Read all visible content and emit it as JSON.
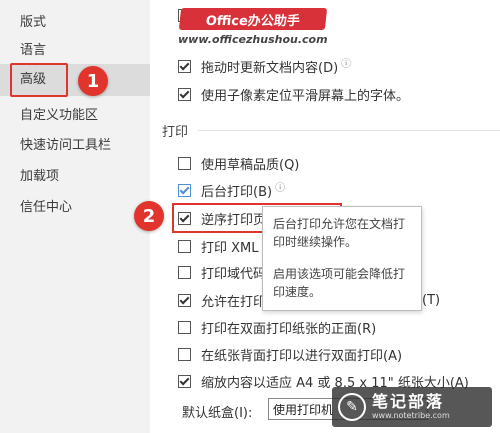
{
  "sidebar": {
    "items": [
      {
        "label": "版式"
      },
      {
        "label": "语言"
      },
      {
        "label": "高级"
      },
      {
        "label": "自定义功能区"
      },
      {
        "label": "快速访问工具栏"
      },
      {
        "label": "加载项"
      },
      {
        "label": "信任中心"
      }
    ],
    "selected": "高级"
  },
  "badges": {
    "one": "1",
    "two": "2"
  },
  "watermark": {
    "banner": "Office办公助手",
    "url": "www.officezhushou.com",
    "corner_title": "笔记部落",
    "corner_url": "www.notetribe.com"
  },
  "options_top": [
    {
      "label": "拖动时更新文档内容(D)",
      "checked": true,
      "info": "ⓘ"
    },
    {
      "label": "使用子像素定位平滑屏幕上的字体。",
      "checked": true
    }
  ],
  "print_section": {
    "title": "打印",
    "options": [
      {
        "label": "使用草稿品质(Q)",
        "checked": false
      },
      {
        "label": "后台打印(B)",
        "checked": true,
        "info": "ⓘ"
      },
      {
        "label": "逆序打印页",
        "checked": true
      },
      {
        "label": "打印 XML",
        "checked": false
      },
      {
        "label": "打印域代码",
        "checked": false
      },
      {
        "label": "允许在打印",
        "checked": true,
        "suffix": "(T)"
      },
      {
        "label": "打印在双面打印纸张的正面(R)",
        "checked": false
      },
      {
        "label": "在纸张背面打印以进行双面打印(A)",
        "checked": false
      },
      {
        "label": "缩放内容以适应 A4 或 8.5 x 11\" 纸张大小(A)",
        "checked": true
      }
    ]
  },
  "tooltip": {
    "line1": "后台打印允许您在文档打印时继续操作。",
    "line2": "启用该选项可能会降低打印速度。"
  },
  "tray": {
    "label": "默认纸盒(I):",
    "value": "使用打印机"
  },
  "colors": {
    "accent_red": "#e0342c",
    "sidebar_bg": "#f2f2f2"
  }
}
